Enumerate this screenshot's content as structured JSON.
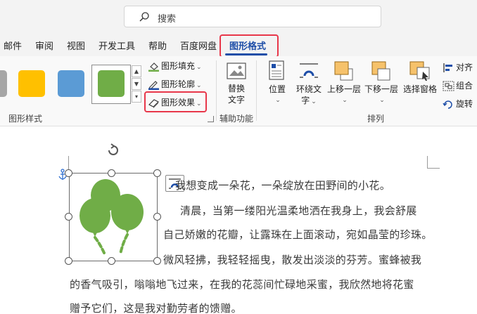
{
  "search": {
    "placeholder": "搜索"
  },
  "tabs": [
    {
      "label": "邮件"
    },
    {
      "label": "审阅"
    },
    {
      "label": "视图"
    },
    {
      "label": "开发工具"
    },
    {
      "label": "帮助"
    },
    {
      "label": "百度网盘"
    },
    {
      "label": "图形格式",
      "active": true
    }
  ],
  "ribbon": {
    "shape_styles": {
      "swatch_colors": [
        "#a6a6a6",
        "#ffc000",
        "#5b9bd5",
        "#70ad47"
      ],
      "fill_label": "图形填充",
      "outline_label": "图形轮廓",
      "effects_label": "图形效果",
      "group_label": "图形样式"
    },
    "accessibility": {
      "alt_text_line1": "替换",
      "alt_text_line2": "文字",
      "group_label": "辅助功能"
    },
    "arrange": {
      "position_label": "位置",
      "wrap_text_line1": "环绕文",
      "wrap_text_line2": "字",
      "bring_forward_label": "上移一层",
      "send_backward_label": "下移一层",
      "selection_pane_label": "选择窗格",
      "align_label": "对齐",
      "group_label_btn": "组合",
      "rotate_label": "旋转",
      "group_label": "排列"
    }
  },
  "document": {
    "paragraphs": [
      "我想变成一朵花，一朵绽放在田野间的小花。",
      "清晨，当第一缕阳光温柔地洒在我身上，我会舒展",
      "自己娇嫩的花瓣，让露珠在上面滚动，宛如晶莹的珍珠。",
      "微风轻拂，我轻轻摇曳，散发出淡淡的芬芳。蜜蜂被我",
      "的香气吸引，嗡嗡地飞过来，在我的花蕊间忙碌地采蜜，我欣然地将花蜜",
      "赠予它们，这是我对勤劳者的馈赠。"
    ],
    "icon_color": "#70ad47"
  },
  "colors": {
    "accent": "#1e4ea8",
    "highlight_border": "#e8374a"
  }
}
